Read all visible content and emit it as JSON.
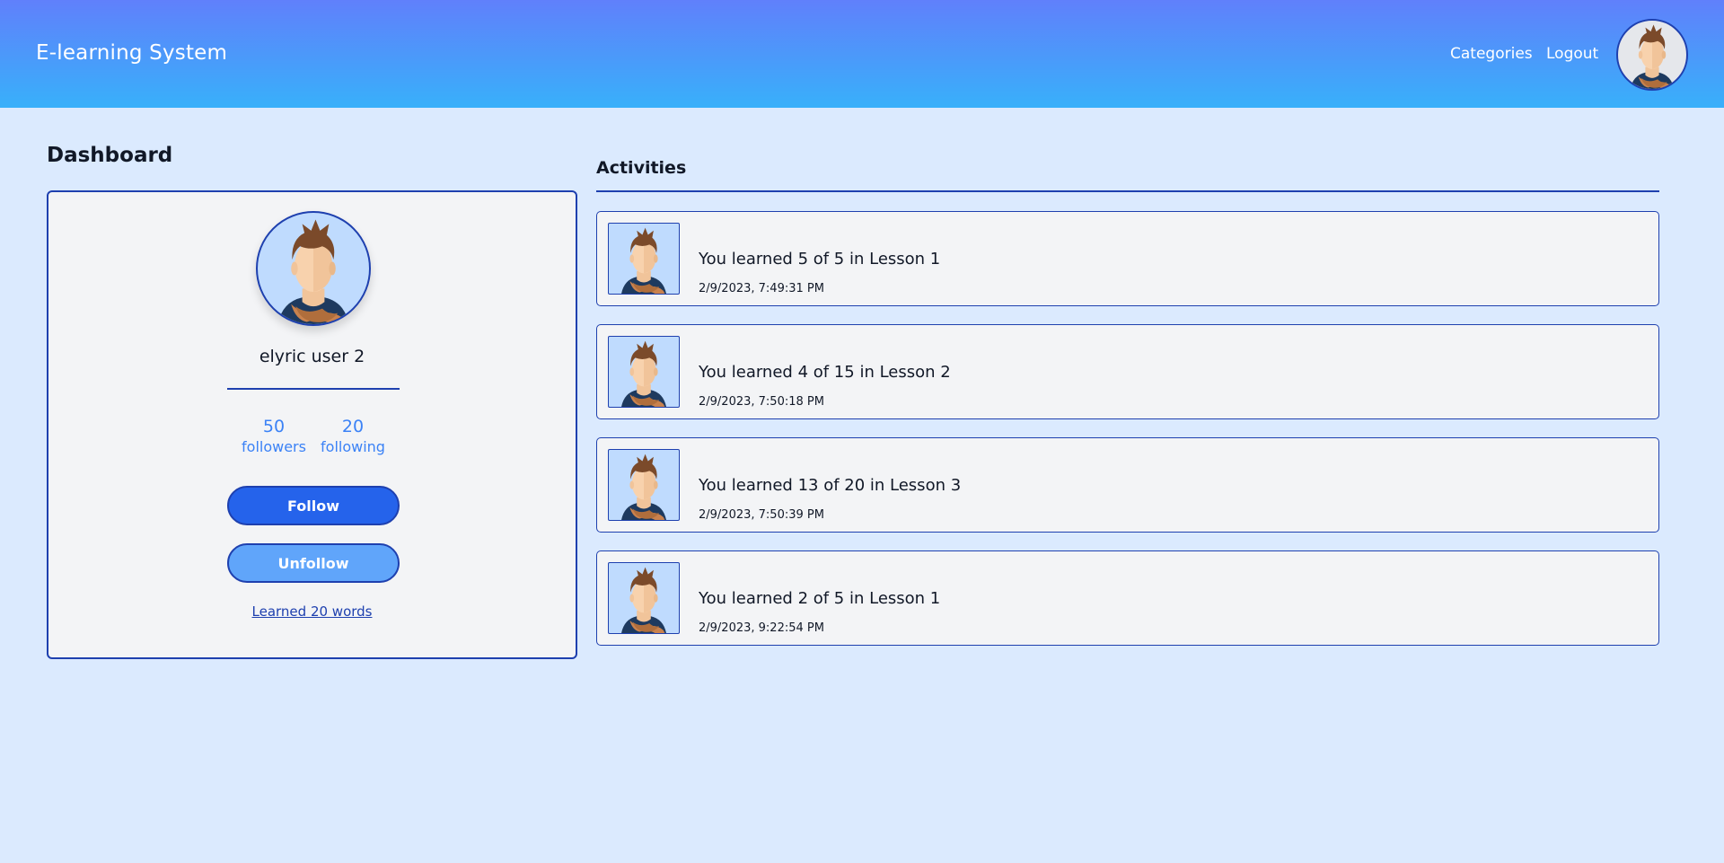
{
  "header": {
    "brand": "E-learning System",
    "nav": {
      "categories": "Categories",
      "logout": "Logout"
    },
    "avatar_icon": "user-avatar-icon"
  },
  "dashboard": {
    "title": "Dashboard",
    "profile": {
      "username": "elyric user 2",
      "followers_count": "50",
      "followers_label": "followers",
      "following_count": "20",
      "following_label": "following",
      "follow_label": "Follow",
      "unfollow_label": "Unfollow",
      "learned_link": "Learned 20 words"
    }
  },
  "activities": {
    "title": "Activities",
    "items": [
      {
        "text": "You learned 5 of 5 in Lesson 1",
        "time": "2/9/2023, 7:49:31 PM"
      },
      {
        "text": "You learned 4 of 15 in Lesson 2",
        "time": "2/9/2023, 7:50:18 PM"
      },
      {
        "text": "You learned 13 of 20 in Lesson 3",
        "time": "2/9/2023, 7:50:39 PM"
      },
      {
        "text": "You learned 2 of 5 in Lesson 1",
        "time": "2/9/2023, 9:22:54 PM"
      }
    ]
  },
  "colors": {
    "header_gradient_top": "#6080fb",
    "header_gradient_bottom": "#38b0fa",
    "page_background": "#dbeafe",
    "border_accent": "#1e40af",
    "follow_button": "#2563eb",
    "unfollow_button": "#60a5fa",
    "stat_text": "#3b82f6"
  }
}
